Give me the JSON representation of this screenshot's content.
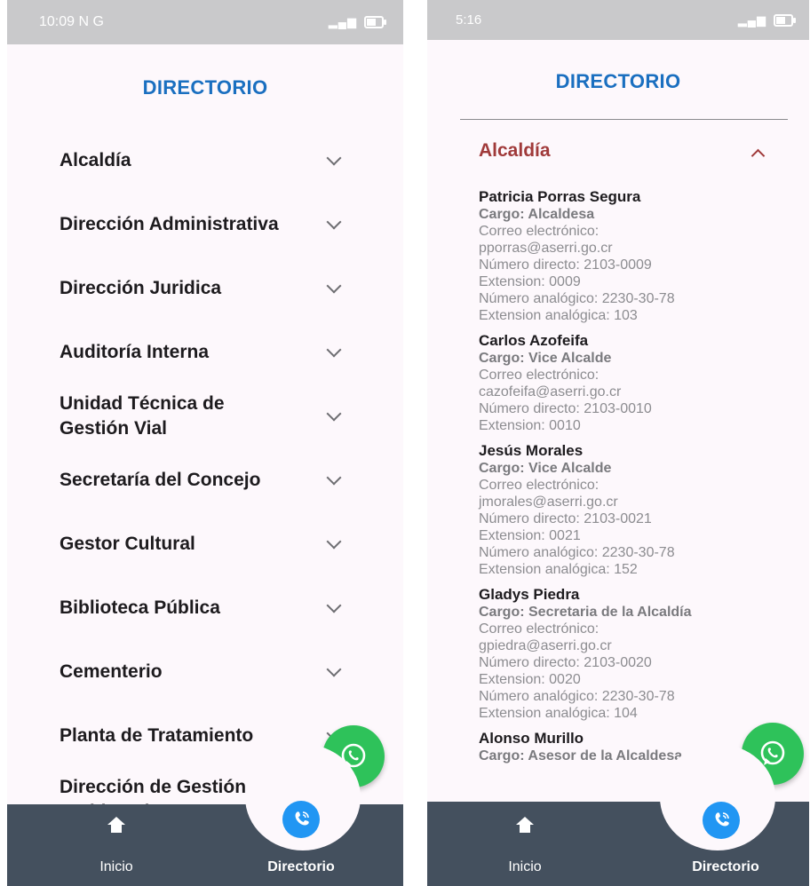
{
  "left": {
    "status_time": "10:09",
    "status_extra": "N G",
    "title": "DIRECTORIO",
    "items": [
      {
        "label": "Alcaldía"
      },
      {
        "label": "Dirección Administrativa"
      },
      {
        "label": "Dirección Juridica"
      },
      {
        "label": "Auditoría Interna"
      },
      {
        "label": "Unidad Técnica de Gestión Vial"
      },
      {
        "label": "Secretaría del Concejo"
      },
      {
        "label": "Gestor Cultural"
      },
      {
        "label": "Biblioteca Pública"
      },
      {
        "label": "Cementerio"
      },
      {
        "label": "Planta de Tratamiento"
      },
      {
        "label": "Dirección de Gestión Ambiental"
      }
    ],
    "nav": {
      "home_label": "Inicio",
      "directory_label": "Directorio"
    }
  },
  "right": {
    "status_time": "5:16",
    "title": "DIRECTORIO",
    "section": "Alcaldía",
    "contacts": [
      {
        "name": "Patricia Porras Segura",
        "role": "Cargo: Alcaldesa",
        "email_label": "Correo electrónico:",
        "email": "pporras@aserri.go.cr",
        "direct": "Número directo: 2103-0009",
        "ext": "Extension: 0009",
        "analog": "Número analógico: 2230-30-78",
        "analog_ext": "Extension analógica: 103"
      },
      {
        "name": "Carlos Azofeifa",
        "role": "Cargo: Vice Alcalde",
        "email_label": "Correo electrónico:",
        "email": "cazofeifa@aserri.go.cr",
        "direct": "Número directo: 2103-0010",
        "ext": "Extension: 0010"
      },
      {
        "name": "Jesús Morales",
        "role": "Cargo: Vice Alcalde",
        "email_label": "Correo electrónico:",
        "email": "jmorales@aserri.go.cr",
        "direct": "Número directo: 2103-0021",
        "ext": "Extension: 0021",
        "analog": "Número analógico: 2230-30-78",
        "analog_ext": "Extension analógica: 152"
      },
      {
        "name": "Gladys Piedra",
        "role": "Cargo: Secretaria de la Alcaldía",
        "email_label": "Correo electrónico:",
        "email": "gpiedra@aserri.go.cr",
        "direct": "Número directo: 2103-0020",
        "ext": "Extension: 0020",
        "analog": "Número analógico: 2230-30-78",
        "analog_ext": "Extension analógica: 104"
      },
      {
        "name": "Alonso Murillo",
        "role": "Cargo: Asesor de la Alcaldesa"
      }
    ],
    "nav": {
      "home_label": "Inicio",
      "directory_label": "Directorio"
    }
  },
  "colors": {
    "title_blue": "#1a6fc0",
    "section_red": "#a03a3a",
    "nav_bg": "#44505e",
    "fab_blue": "#2196f3",
    "whatsapp_green": "#2ec25a"
  }
}
